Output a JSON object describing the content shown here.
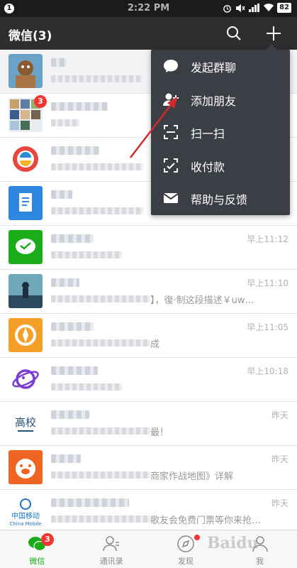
{
  "status_bar": {
    "notification_count": "1",
    "time": "2:22 PM",
    "battery": "82"
  },
  "header": {
    "title": "微信(3)"
  },
  "menu": {
    "items": [
      {
        "label": "发起群聊",
        "icon": "chat-bubble-icon"
      },
      {
        "label": "添加朋友",
        "icon": "add-friend-icon"
      },
      {
        "label": "扫一扫",
        "icon": "scan-icon"
      },
      {
        "label": "收付款",
        "icon": "payment-icon"
      },
      {
        "label": "帮助与反馈",
        "icon": "mail-icon"
      }
    ]
  },
  "chats": [
    {
      "time": "",
      "message": "",
      "badge": ""
    },
    {
      "time": "",
      "message": "",
      "badge": "3"
    },
    {
      "time": "",
      "message": "",
      "badge": ""
    },
    {
      "time": "",
      "message": "",
      "badge": ""
    },
    {
      "time": "早上11:12",
      "message": "",
      "badge": ""
    },
    {
      "time": "早上11:10",
      "message": "】，復·制这段描述￥uw…",
      "badge": ""
    },
    {
      "time": "早上11:05",
      "message": "成",
      "badge": ""
    },
    {
      "time": "早上10:18",
      "message": "",
      "badge": ""
    },
    {
      "time": "昨天",
      "message": "最！",
      "badge": ""
    },
    {
      "time": "昨天",
      "message": "商家作战地图》详解",
      "badge": ""
    },
    {
      "time": "昨天",
      "message": "歌友会免费门票等你来抢…",
      "badge": ""
    }
  ],
  "avatar_text": {
    "gaoxiao": "高校",
    "china_mobile_cn": "中国移动",
    "china_mobile_en": "China Mobile"
  },
  "tabs": [
    {
      "label": "微信",
      "badge": "3"
    },
    {
      "label": "通讯录"
    },
    {
      "label": "发现"
    },
    {
      "label": "我"
    }
  ],
  "watermark": "Baidu",
  "colors": {
    "brand_green": "#1aad19",
    "header_bg": "#2e2e2e",
    "menu_bg": "#3b3e45",
    "badge_red": "#f43530",
    "arrow_red": "#d42a2a"
  }
}
